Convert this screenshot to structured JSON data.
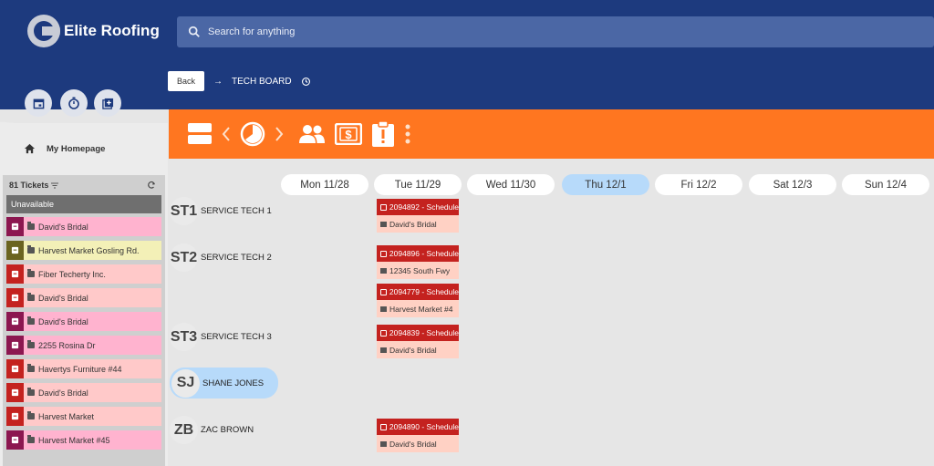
{
  "app": {
    "name": "Elite Roofing"
  },
  "search": {
    "placeholder": "Search for anything"
  },
  "breadcrumb": {
    "back_label": "Back",
    "current": "TECH BOARD"
  },
  "sidebar": {
    "home_label": "My Homepage"
  },
  "tickets": {
    "count_label": "81 Tickets",
    "unavailable_label": "Unavailable",
    "items": [
      {
        "label": "David's Bridal",
        "badge_color": "#8c1750",
        "row_color": "#ffb3cf"
      },
      {
        "label": "Harvest Market Gosling Rd.",
        "badge_color": "#6b6420",
        "row_color": "#f3f0b7"
      },
      {
        "label": "Fiber Techerty Inc.",
        "badge_color": "#c4221f",
        "row_color": "#ffc9c9"
      },
      {
        "label": "David's Bridal",
        "badge_color": "#c4221f",
        "row_color": "#ffc9c9"
      },
      {
        "label": "David's Bridal",
        "badge_color": "#8c1750",
        "row_color": "#ffb3cf"
      },
      {
        "label": "2255 Rosina Dr",
        "badge_color": "#8c1750",
        "row_color": "#ffb3cf"
      },
      {
        "label": "Havertys Furniture #44",
        "badge_color": "#c4221f",
        "row_color": "#ffc9c9"
      },
      {
        "label": "David's Bridal",
        "badge_color": "#c4221f",
        "row_color": "#ffc9c9"
      },
      {
        "label": "Harvest Market",
        "badge_color": "#c4221f",
        "row_color": "#ffc9c9"
      },
      {
        "label": "Harvest Market #45",
        "badge_color": "#8c1750",
        "row_color": "#ffb3cf"
      }
    ]
  },
  "days": [
    {
      "label": "Mon 11/28",
      "active": false
    },
    {
      "label": "Tue 11/29",
      "active": false
    },
    {
      "label": "Wed 11/30",
      "active": false
    },
    {
      "label": "Thu 12/1",
      "active": true
    },
    {
      "label": "Fri 12/2",
      "active": false
    },
    {
      "label": "Sat 12/3",
      "active": false
    },
    {
      "label": "Sun 12/4",
      "active": false
    }
  ],
  "techs": [
    {
      "initials": "ST1",
      "name": "SERVICE TECH 1"
    },
    {
      "initials": "ST2",
      "name": "SERVICE TECH 2"
    },
    {
      "initials": "ST3",
      "name": "SERVICE TECH 3"
    },
    {
      "initials": "SJ",
      "name": "SHANE JONES"
    },
    {
      "initials": "ZB",
      "name": "ZAC BROWN"
    }
  ],
  "jobs": [
    {
      "head": "2094892 - Schedule",
      "location": "David's Bridal"
    },
    {
      "head": "2094896 - Schedule",
      "location": "12345 South Fwy"
    },
    {
      "head": "2094779 - Schedule",
      "location": "Harvest Market #4"
    },
    {
      "head": "2094839 - Schedule",
      "location": "David's Bridal"
    },
    {
      "head": "2094890 - Schedule",
      "location": "David's Bridal"
    }
  ],
  "colors": {
    "nav": "#1d3a7e",
    "toolbar": "#ff7620",
    "active_day": "#b7dafa",
    "job_head": "#c4221f",
    "job_body": "#ffd1c4"
  },
  "icons": {
    "quick_actions": [
      "calendar-icon",
      "stopwatch-icon",
      "add-box-icon"
    ],
    "toolbar": [
      "board-view-icon",
      "chevron-left-icon",
      "clock-icon",
      "chevron-right-icon",
      "team-icon",
      "dollar-icon",
      "alert-clipboard-icon",
      "more-vertical-icon"
    ]
  }
}
